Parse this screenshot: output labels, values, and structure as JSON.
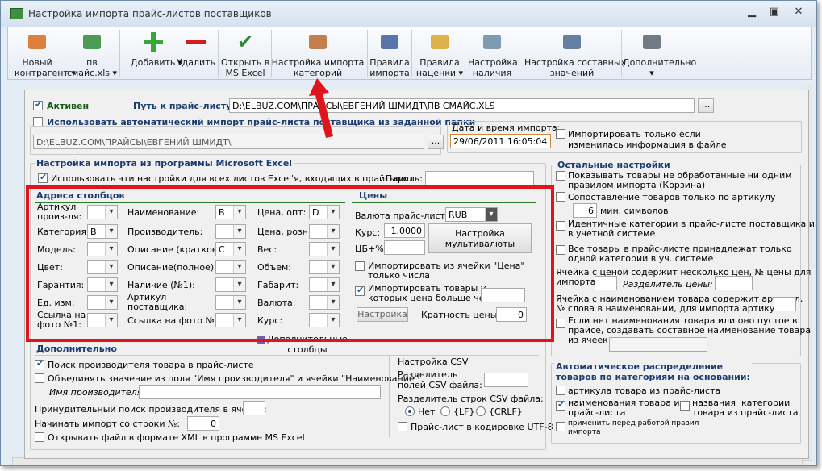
{
  "window": {
    "title": "Настройка импорта прайс-листов поставщиков"
  },
  "toolbar": [
    {
      "id": "new",
      "label": "Новый\nконтрагент ▾",
      "icon": "truck-icon"
    },
    {
      "id": "pv",
      "label": "пв\nсмайс.xls ▾",
      "icon": "xls-icon"
    },
    {
      "id": "add",
      "label": "Добавить ▾",
      "icon": "plus-icon"
    },
    {
      "id": "del",
      "label": "Удалить",
      "icon": "minus-icon"
    },
    {
      "id": "excel",
      "label": "Открыть в\nMS Excel",
      "icon": "checkmark-icon"
    },
    {
      "id": "cat",
      "label": "Настройка импорта\nкатегорий",
      "icon": "category-icon"
    },
    {
      "id": "rules",
      "label": "Правила\nимпорта",
      "icon": "quill-icon"
    },
    {
      "id": "markup",
      "label": "Правила\nнаценки ▾",
      "icon": "coins-icon"
    },
    {
      "id": "stock",
      "label": "Настройка\nналичия",
      "icon": "cart-icon"
    },
    {
      "id": "compose",
      "label": "Настройка составных\nзначений",
      "icon": "document-icon"
    },
    {
      "id": "more",
      "label": "Дополнительно\n▾",
      "icon": "keyboard-icon"
    }
  ],
  "top": {
    "active_label": "Активен",
    "path_label": "Путь к прайс-листу:",
    "path_value": "D:\\ELBUZ.COM\\ПРАЙСЫ\\ЕВГЕНИЙ ШМИДТ\\ПВ СМАЙС.XLS",
    "browse": "...",
    "auto_label": "Использовать автоматический импорт прайс-листа поставщика из заданной папки",
    "auto_path": "D:\\ELBUZ.COM\\ПРАЙСЫ\\ЕВГЕНИЙ ШМИДТ\\",
    "date_label": "Дата и время импорта:",
    "date_value": "29/06/2011 16:05:04",
    "only_changed": "Импортировать только если\nизменилась информация в файле"
  },
  "excel": {
    "title": "Настройка импорта из программы Microsoft Excel",
    "use_all": "Использовать эти настройки для всех листов Excel'я, входящих в прайс-лист",
    "password": "Пароль:"
  },
  "columns": {
    "title": "Адреса столбцов",
    "col1": [
      {
        "l": "Артикул\nпроиз-ля:",
        "v": ""
      },
      {
        "l": "Категория:",
        "v": "B"
      },
      {
        "l": "Модель:",
        "v": ""
      },
      {
        "l": "Цвет:",
        "v": ""
      },
      {
        "l": "Гарантия:",
        "v": ""
      },
      {
        "l": "Ед. изм:",
        "v": ""
      },
      {
        "l": "Ссылка на\nфото №1:",
        "v": ""
      }
    ],
    "col2": [
      {
        "l": "Наименование:",
        "v": "B"
      },
      {
        "l": "Производитель:",
        "v": ""
      },
      {
        "l": "Описание (краткое):",
        "v": "C"
      },
      {
        "l": "Описание(полное):",
        "v": ""
      },
      {
        "l": "Наличие (№1):",
        "v": ""
      },
      {
        "l": "Артикул\nпоставщика:",
        "v": ""
      },
      {
        "l": "Ссылка на фото №2:",
        "v": ""
      }
    ],
    "col3": [
      {
        "l": "Цена, опт:",
        "v": "D"
      },
      {
        "l": "Цена, розн.:",
        "v": ""
      },
      {
        "l": "Вес:",
        "v": ""
      },
      {
        "l": "Объем:",
        "v": ""
      },
      {
        "l": "Габарит:",
        "v": ""
      },
      {
        "l": "Валюта:",
        "v": ""
      },
      {
        "l": "Курс:",
        "v": ""
      }
    ],
    "extra": "Дополнительные\nстолбцы"
  },
  "prices": {
    "title": "Цены",
    "currency_label": "Валюта прайс-листа:",
    "currency": "RUB",
    "rate_label": "Курс:",
    "rate": "1.0000",
    "cb_label": "ЦБ+%",
    "multi_btn": "Настройка\nмультивалюты",
    "from_cell": "Импортировать из ячейки \"Цена\"\nтолько числа",
    "gt_price": "Импортировать товары у\nкоторых цена больше чем:",
    "setup_btn": "Настройка",
    "mult_label": "Кратность цены:",
    "mult_value": "0"
  },
  "extra_sec": {
    "title": "Дополнительно",
    "find_maker": "Поиск производителя товара в прайс-листе",
    "merge": "Объединять значение из поля \"Имя производителя\" и ячейки \"Наименование\"",
    "maker_name": "Имя производителя:",
    "forced": "Принудительный поиск производителя в ячейке:",
    "start_row": "Начинать импорт со строки №:",
    "start_value": "0",
    "xml": "Открывать файл в формате XML в программе MS Excel"
  },
  "csv": {
    "title": "Настройка CSV",
    "field_sep": "Разделитель\nполей CSV файла:",
    "row_sep": "Разделитель строк CSV файла:",
    "opts": [
      "Нет",
      "{LF}",
      "{CRLF}"
    ],
    "utf8": "Прайс-лист в кодировке UTF-8"
  },
  "other": {
    "title": "Остальные настройки",
    "items": [
      "Показывать товары не обработанные ни одним\nправилом импорта (Корзина)",
      "Сопоставление товаров только по артикулу"
    ],
    "min_value": "6",
    "min_label": "мин. символов",
    "identical": "Идентичные категории в прайс-листе поставщика и\nв учетной системе",
    "all_one": "Все товары в прайс-листе принадлежат только\nодной категории в уч. системе",
    "multi_price": "Ячейка с ценой содержит несколько цен, № цены для\nимпорта:",
    "price_sep": "Разделитель цены:",
    "art_word": "Ячейка с наименованием товара содержит артикул,\n№ слова в наименовании, для импорта артикула:",
    "no_name": "Если нет наименования товара или оно пустое в\nпрайсе, создавать составное наименование товара\nиз ячеек:"
  },
  "auto_dist": {
    "title": "Автоматическое распределение\nтоваров по категориям на основании:",
    "by_article": "артикула товара из прайс-листа",
    "by_name": "наименования товара из\nпрайс-листа",
    "by_cat": "названия  категории\nтовара из прайс-листа",
    "before": "применить перед работой правил\nимпорта"
  }
}
